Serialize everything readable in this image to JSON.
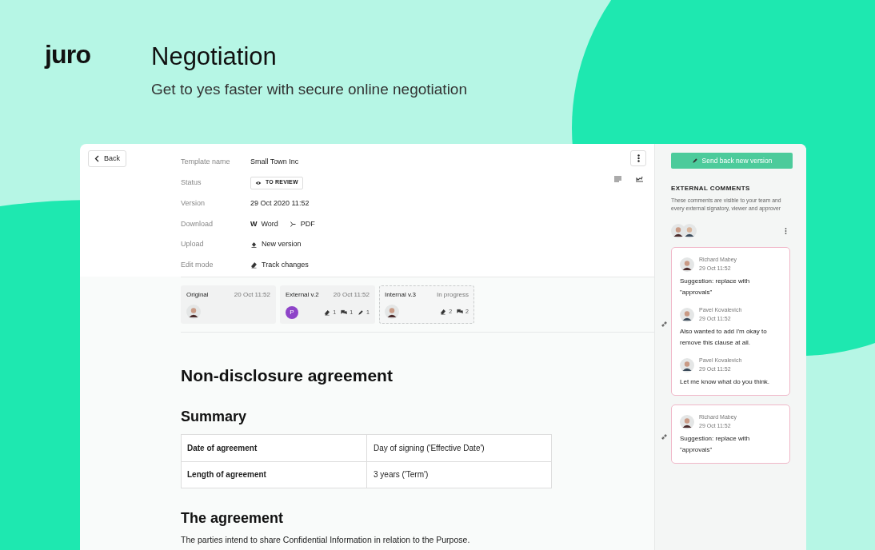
{
  "logo": "juro",
  "title": "Negotiation",
  "subtitle": "Get to yes faster with secure online negotiation",
  "back_button": "Back",
  "details": [
    {
      "label": "Template name",
      "kind": "text",
      "value": "Small Town Inc"
    },
    {
      "label": "Status",
      "kind": "badge",
      "value": "TO REVIEW"
    },
    {
      "label": "Version",
      "kind": "text",
      "value": "29 Oct 2020 11:52"
    },
    {
      "label": "Download",
      "kind": "links",
      "links": [
        {
          "kind": "word",
          "glyph": "W",
          "label": "Word"
        },
        {
          "kind": "pdf",
          "label": "PDF"
        }
      ]
    },
    {
      "label": "Upload",
      "kind": "links",
      "links": [
        {
          "kind": "upload",
          "label": "New version"
        }
      ]
    },
    {
      "label": "Edit mode",
      "kind": "links",
      "links": [
        {
          "kind": "eraser",
          "label": "Track changes"
        }
      ]
    }
  ],
  "versions": [
    {
      "name": "Original",
      "date": "20 Oct 11:52",
      "selected": false,
      "avatar": {
        "kind": "photo"
      }
    },
    {
      "name": "External v.2",
      "date": "20 Oct 11:52",
      "selected": false,
      "avatar": {
        "kind": "letter",
        "letter": "P"
      },
      "counts": [
        {
          "kind": "eraser",
          "value": "1"
        },
        {
          "kind": "comment",
          "value": "1"
        },
        {
          "kind": "pencil",
          "value": "1"
        }
      ]
    },
    {
      "name": "Internal v.3",
      "date": "In progress",
      "selected": true,
      "avatar": {
        "kind": "photo"
      },
      "counts": [
        {
          "kind": "eraser",
          "value": "2"
        },
        {
          "kind": "comment",
          "value": "2"
        }
      ]
    }
  ],
  "document": {
    "title": "Non-disclosure agreement",
    "summary_heading": "Summary",
    "summary_rows": [
      {
        "label": "Date of agreement",
        "value": "Day of signing ('Effective Date')"
      },
      {
        "label": "Length of agreement",
        "value": "3 years ('Term')"
      }
    ],
    "section_heading": "The agreement",
    "paragraph": "The parties intend to share Confidential Information in relation to the Purpose."
  },
  "sidebar": {
    "send_button": "Send back new version",
    "section_title": "EXTERNAL COMMENTS",
    "description": "These comments are visible to your team and every external signatory, viewer and approver",
    "threads": [
      {
        "entries": [
          {
            "author": "Richard Mabey",
            "time": "29 Oct 11:52",
            "text": "Suggestion: replace with \"approvals\""
          },
          {
            "author": "Pavel Kovalevich",
            "time": "29 Oct 11:52",
            "text": "Also wanted to add I'm okay to remove this clause at all."
          },
          {
            "author": "Pavel Kovalevich",
            "time": "29 Oct 11:52",
            "text": "Let me know what do you think."
          }
        ]
      },
      {
        "entries": [
          {
            "author": "Richard Mabey",
            "time": "29 Oct 11:52",
            "text": "Suggestion: replace with \"approvals\""
          }
        ]
      }
    ]
  }
}
